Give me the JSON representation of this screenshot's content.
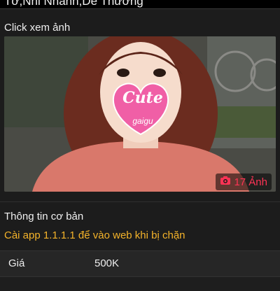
{
  "header": {
    "title": "Tớ,Nhỉ Nhanh,Dễ Thương"
  },
  "gallery": {
    "click_label": "Click xem ảnh",
    "sticker_text": "Cute",
    "sticker_sub": "gaigu",
    "photo_count_label": "17 Ảnh",
    "accent_color": "#ff3355"
  },
  "info": {
    "section_title": "Thông tin cơ bản",
    "notice": "Cài app 1.1.1.1 để vào web khi bị chặn",
    "notice_color": "#f4b32a",
    "rows": [
      {
        "key": "Giá",
        "value": "500K"
      }
    ]
  }
}
